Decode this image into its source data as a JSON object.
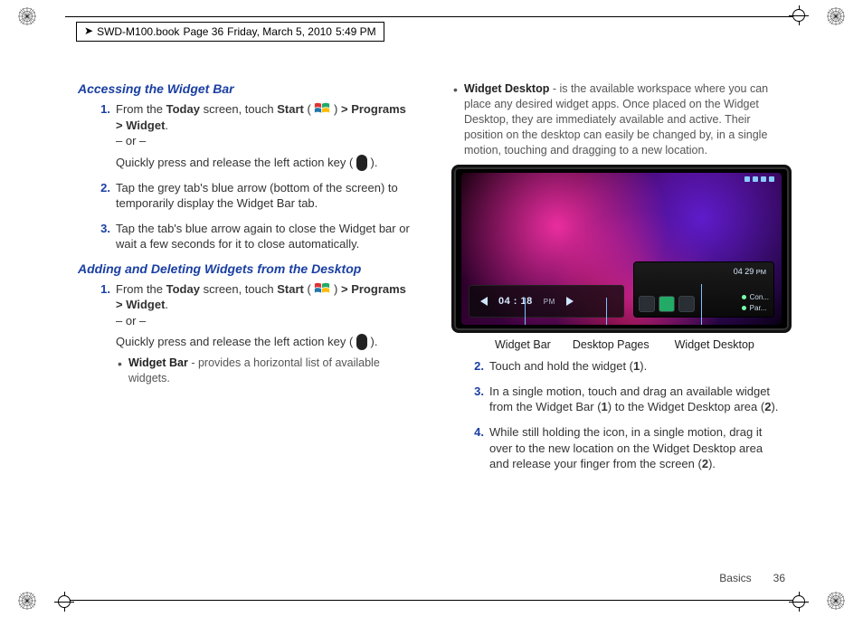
{
  "runhead": {
    "book": "SWD-M100.book",
    "page_label": "Page 36",
    "date": "Friday, March 5, 2010",
    "time": "5:49 PM"
  },
  "left": {
    "section1_title": "Accessing the Widget Bar",
    "s1_step1_a": "From the ",
    "s1_step1_b": "Today",
    "s1_step1_c": " screen, touch ",
    "s1_step1_d": "Start",
    "s1_step1_e": " ( ",
    "s1_step1_f": " ) ",
    "s1_step1_g": "> Programs > Widget",
    "s1_step1_h": ".",
    "or": "– or –",
    "action_key_line_a": "Quickly press and release the left action key ( ",
    "action_key_line_b": " ).",
    "s1_step2": "Tap the grey tab's blue arrow (bottom of the screen) to temporarily display the Widget Bar tab.",
    "s1_step3": "Tap the tab's blue arrow again to close the Widget bar or wait a few seconds for it to close automatically.",
    "section2_title": "Adding and Deleting Widgets from the Desktop",
    "s2_step1_a": "From the ",
    "s2_step1_b": "Today",
    "s2_step1_c": " screen, touch ",
    "s2_step1_d": "Start",
    "s2_step1_e": " ( ",
    "s2_step1_f": " ) ",
    "s2_step1_g": "> Programs > Widget",
    "s2_step1_h": ".",
    "wb_term": "Widget Bar",
    "wb_desc": " - provides a horizontal list of available widgets."
  },
  "right": {
    "wd_term": "Widget Desktop",
    "wd_desc": " - is the available workspace where you can place any desired widget apps. Once placed on the Widget Desktop, they are immediately available and active. Their position on the desktop can easily be changed by, in a single motion, touching and dragging to a new location.",
    "playbar_time": "04 : 18",
    "playbar_ampm": "PM",
    "dock_time": "04 29",
    "dock_time_ampm": "PM",
    "dock_line1": "Con...",
    "dock_line2": "Par...",
    "cap_widget_bar": "Widget Bar",
    "cap_desktop_pages": "Desktop Pages",
    "cap_widget_desktop": "Widget Desktop",
    "step2_a": "Touch and hold the widget (",
    "step2_b": "1",
    "step2_c": ").",
    "step3_a": "In a single motion, touch and drag an available widget from the Widget Bar (",
    "step3_b": "1",
    "step3_c": ") to the Widget Desktop area (",
    "step3_d": "2",
    "step3_e": ").",
    "step4_a": "While still holding the icon, in a single motion, drag it over to the new location on the Widget Desktop area and release your finger from the screen (",
    "step4_b": "2",
    "step4_c": ")."
  },
  "footer": {
    "section": "Basics",
    "page": "36"
  },
  "nums": {
    "n1": "1.",
    "n2": "2.",
    "n3": "3.",
    "n4": "4."
  }
}
